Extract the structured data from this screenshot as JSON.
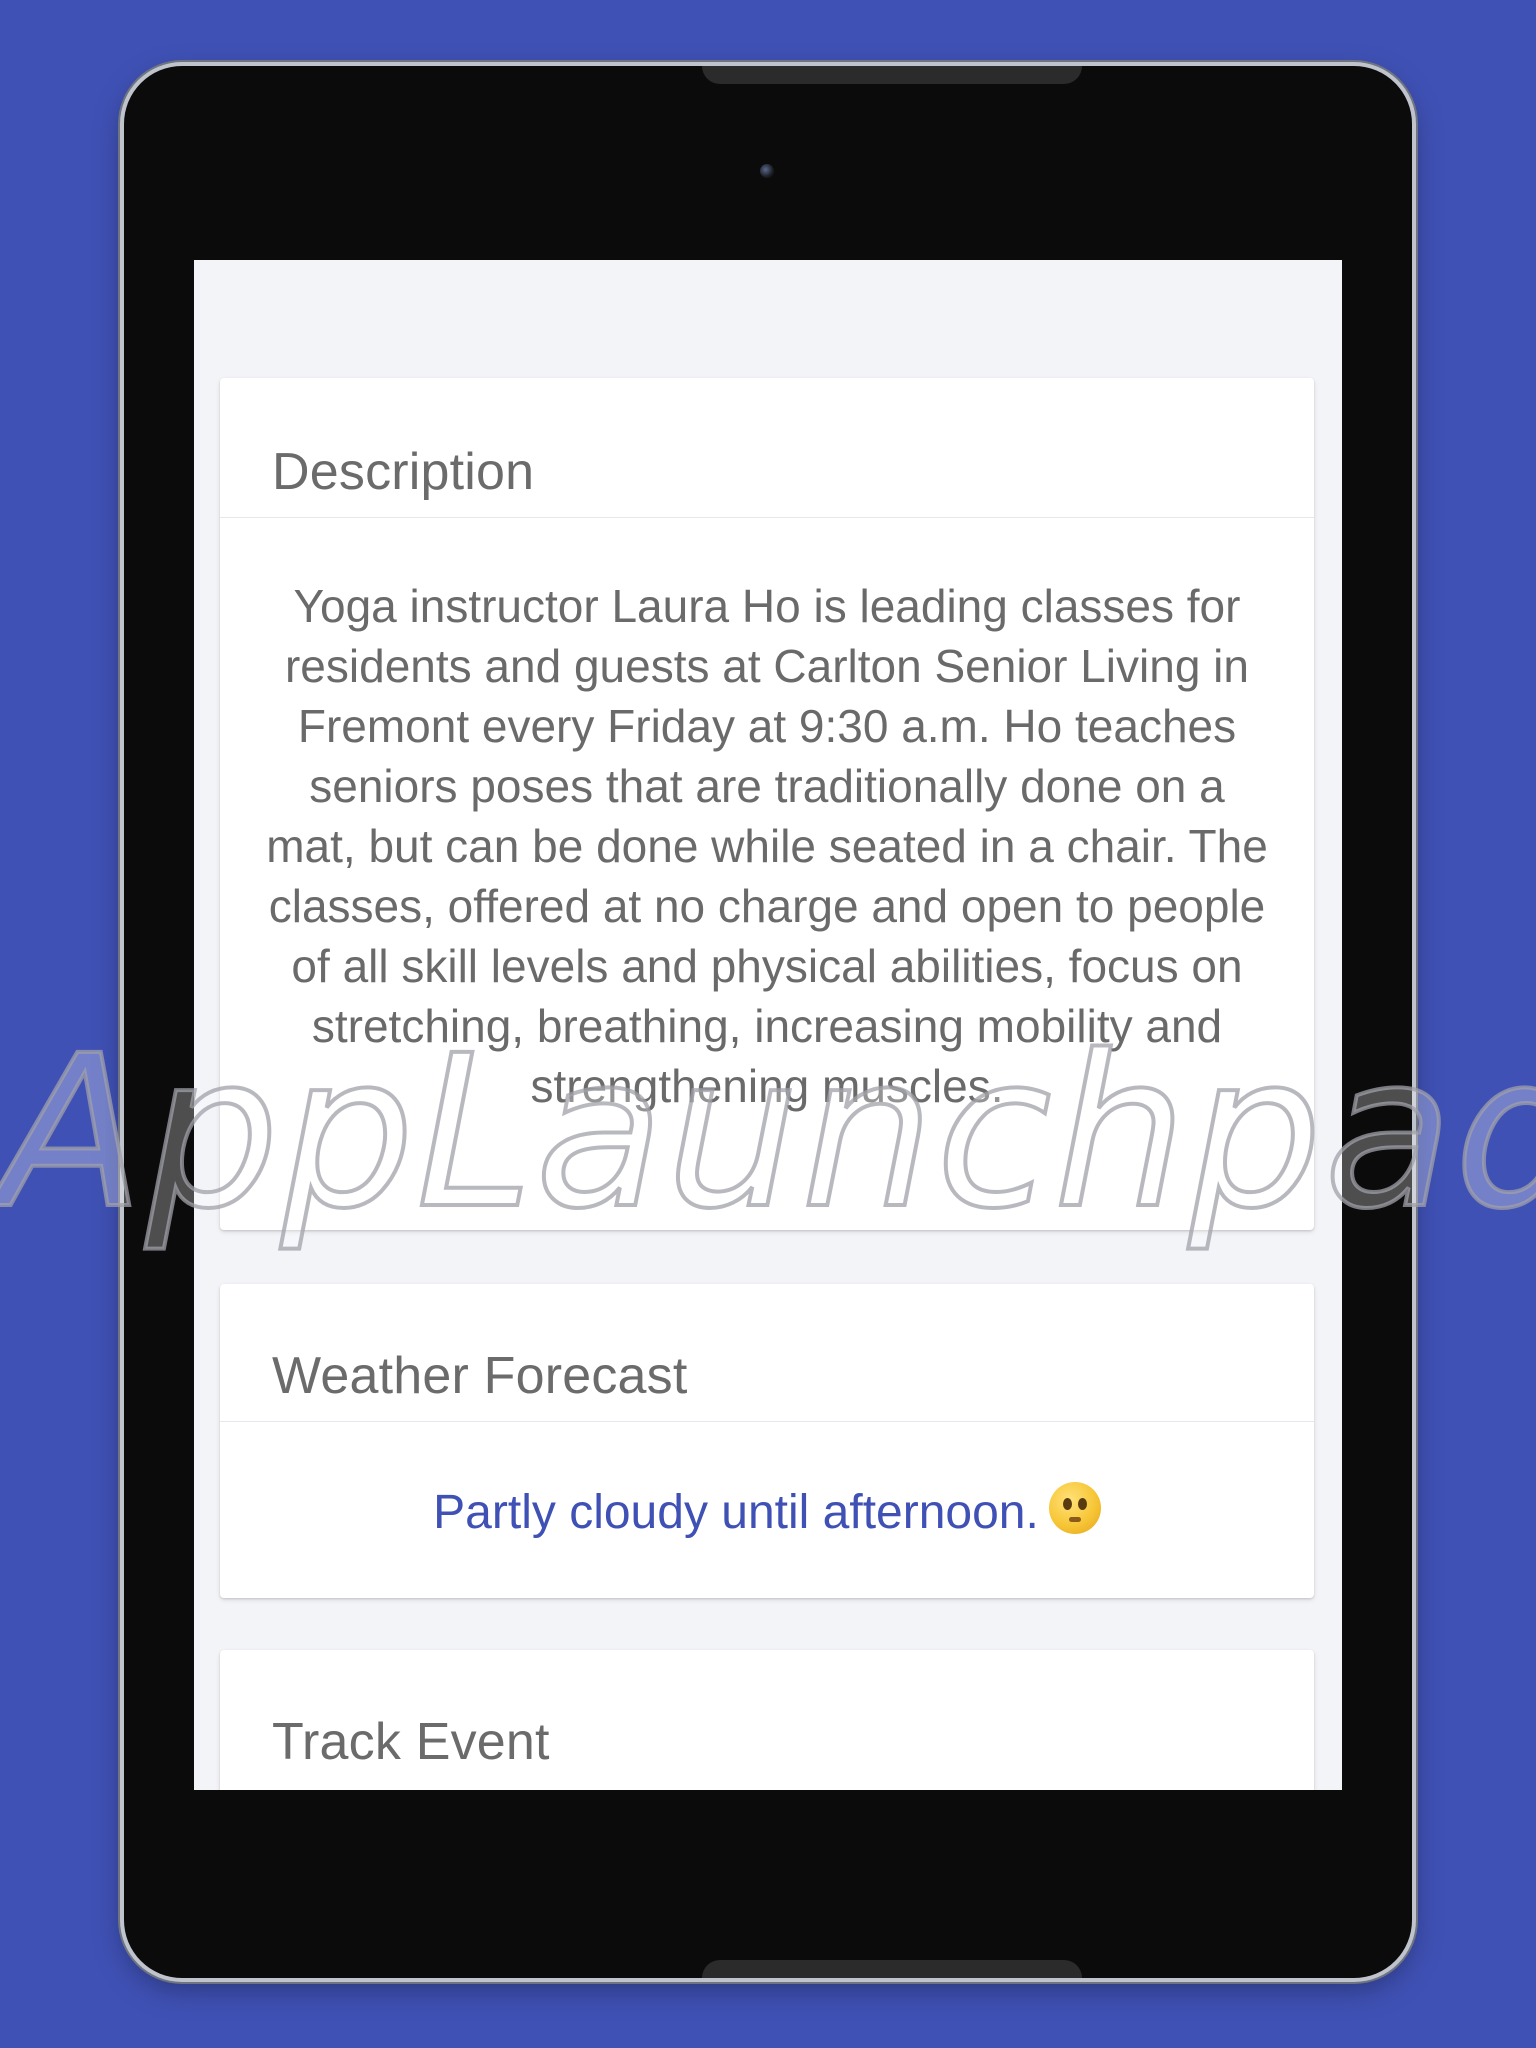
{
  "cards": {
    "description": {
      "title": "Description",
      "body": "Yoga instructor Laura Ho is leading classes for residents and guests at Carlton Senior Living in Fremont every Friday at 9:30 a.m.  Ho teaches seniors poses that are traditionally done on a mat, but can be done while seated in a chair.  The classes, offered at no charge and open to people of all skill levels and physical abilities, focus on stretching, breathing, increasing mobility and strengthening muscles."
    },
    "weather": {
      "title": "Weather Forecast",
      "forecast": "Partly cloudy until afternoon.",
      "icon": "neutral-face-emoji"
    },
    "track": {
      "title": "Track Event"
    }
  },
  "watermark": "AppLaunchpad",
  "colors": {
    "background": "#3f51b5",
    "accent": "#3f51b5",
    "screen_bg": "#f3f4f8",
    "card_bg": "#ffffff",
    "title_text": "#6b6b6b"
  }
}
